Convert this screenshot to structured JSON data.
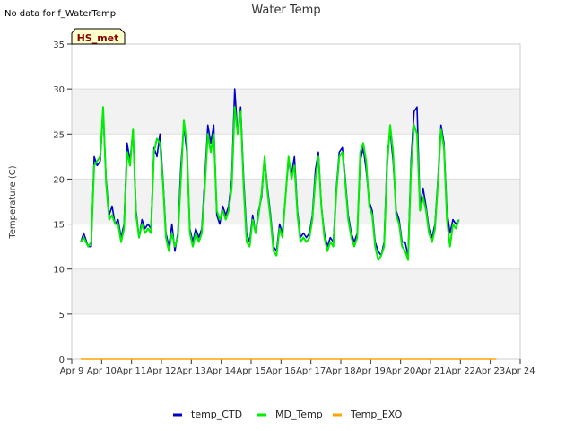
{
  "notice": "No data for f_WaterTemp",
  "badge": "HS_met",
  "chart_data": {
    "type": "line",
    "title": "Water Temp",
    "xlabel": "",
    "ylabel": "Temperature (C)",
    "xlim": [
      "Apr 9",
      "Apr 24"
    ],
    "ylim": [
      0,
      35
    ],
    "x_tick_labels": [
      "Apr 9",
      "Apr 10",
      "Apr 11",
      "Apr 12",
      "Apr 13",
      "Apr 14",
      "Apr 15",
      "Apr 16",
      "Apr 17",
      "Apr 18",
      "Apr 19",
      "Apr 20",
      "Apr 21",
      "Apr 22",
      "Apr 23",
      "Apr 24"
    ],
    "y_ticks": [
      0,
      5,
      10,
      15,
      20,
      25,
      30,
      35
    ],
    "grid": true,
    "legend_position": "bottom",
    "series": [
      {
        "name": "temp_CTD",
        "color": "#0000cc",
        "x_days": [
          9.3,
          9.4,
          9.55,
          9.65,
          9.75,
          9.85,
          9.95,
          10.05,
          10.15,
          10.25,
          10.35,
          10.45,
          10.55,
          10.65,
          10.75,
          10.85,
          10.95,
          11.05,
          11.15,
          11.25,
          11.35,
          11.45,
          11.55,
          11.65,
          11.75,
          11.85,
          11.95,
          12.05,
          12.15,
          12.25,
          12.35,
          12.45,
          12.55,
          12.65,
          12.75,
          12.85,
          12.95,
          13.05,
          13.15,
          13.25,
          13.35,
          13.45,
          13.55,
          13.65,
          13.75,
          13.85,
          13.95,
          14.05,
          14.15,
          14.25,
          14.35,
          14.45,
          14.55,
          14.65,
          14.75,
          14.85,
          14.95,
          15.05,
          15.15,
          15.25,
          15.35,
          15.45,
          15.55,
          15.65,
          15.75,
          15.85,
          15.95,
          16.05,
          16.15,
          16.25,
          16.35,
          16.45,
          16.55,
          16.65,
          16.75,
          16.85,
          16.95,
          17.05,
          17.15,
          17.25,
          17.35,
          17.45,
          17.55,
          17.65,
          17.75,
          17.85,
          17.95,
          18.05,
          18.15,
          18.25,
          18.35,
          18.45,
          18.55,
          18.65,
          18.75,
          18.85,
          18.95,
          19.05,
          19.15,
          19.25,
          19.35,
          19.45,
          19.55,
          19.65,
          19.75,
          19.85,
          19.95,
          20.05,
          20.15,
          20.25,
          20.35,
          20.45,
          20.55,
          20.65,
          20.75,
          20.85,
          20.95,
          21.05,
          21.15,
          21.25,
          21.35,
          21.45,
          21.55,
          21.65,
          21.75,
          21.85,
          21.95,
          22.05,
          22.15,
          22.25,
          22.35,
          22.45,
          22.55,
          22.65,
          22.75,
          22.85,
          22.95,
          23.05,
          23.15,
          23.25
        ],
        "values": [
          13.0,
          14.0,
          12.5,
          12.5,
          22.5,
          21.5,
          22.0,
          27.5,
          20.0,
          16.0,
          17.0,
          15.0,
          15.5,
          13.5,
          15.0,
          24.0,
          22.0,
          25.5,
          16.5,
          13.5,
          15.5,
          14.5,
          15.0,
          14.5,
          23.5,
          22.5,
          25.0,
          20.0,
          14.0,
          12.5,
          15.0,
          12.0,
          14.0,
          21.5,
          26.0,
          23.0,
          14.5,
          13.0,
          14.5,
          13.5,
          14.5,
          20.0,
          26.0,
          24.0,
          26.0,
          16.0,
          15.0,
          17.0,
          16.0,
          17.0,
          20.0,
          30.0,
          25.0,
          28.0,
          20.0,
          14.0,
          13.0,
          16.0,
          14.0,
          16.5,
          18.0,
          22.5,
          19.0,
          16.0,
          12.5,
          12.0,
          15.0,
          14.0,
          18.0,
          22.0,
          20.5,
          22.5,
          16.5,
          13.5,
          14.0,
          13.5,
          14.0,
          16.0,
          21.0,
          23.0,
          17.0,
          14.0,
          12.5,
          13.5,
          13.0,
          19.0,
          23.0,
          23.5,
          20.0,
          16.0,
          14.0,
          13.0,
          14.0,
          22.0,
          23.5,
          21.0,
          17.5,
          16.5,
          13.0,
          12.0,
          11.5,
          13.0,
          22.5,
          25.5,
          22.0,
          16.5,
          15.5,
          13.0,
          13.0,
          11.5,
          22.0,
          27.5,
          28.0,
          17.0,
          19.0,
          17.0,
          14.5,
          13.5,
          15.0,
          20.0,
          26.0,
          24.0,
          16.5,
          14.0,
          15.5,
          15.0,
          15.5
        ]
      },
      {
        "name": "MD_Temp",
        "color": "#00ee00",
        "x_days": [
          9.3,
          9.4,
          9.55,
          9.65,
          9.75,
          9.85,
          9.95,
          10.05,
          10.15,
          10.25,
          10.35,
          10.45,
          10.55,
          10.65,
          10.75,
          10.85,
          10.95,
          11.05,
          11.15,
          11.25,
          11.35,
          11.45,
          11.55,
          11.65,
          11.75,
          11.85,
          11.95,
          12.05,
          12.15,
          12.25,
          12.35,
          12.45,
          12.55,
          12.65,
          12.75,
          12.85,
          12.95,
          13.05,
          13.15,
          13.25,
          13.35,
          13.45,
          13.55,
          13.65,
          13.75,
          13.85,
          13.95,
          14.05,
          14.15,
          14.25,
          14.35,
          14.45,
          14.55,
          14.65,
          14.75,
          14.85,
          14.95,
          15.05,
          15.15,
          15.25,
          15.35,
          15.45,
          15.55,
          15.65,
          15.75,
          15.85,
          15.95,
          16.05,
          16.15,
          16.25,
          16.35,
          16.45,
          16.55,
          16.65,
          16.75,
          16.85,
          16.95,
          17.05,
          17.15,
          17.25,
          17.35,
          17.45,
          17.55,
          17.65,
          17.75,
          17.85,
          17.95,
          18.05,
          18.15,
          18.25,
          18.35,
          18.45,
          18.55,
          18.65,
          18.75,
          18.85,
          18.95,
          19.05,
          19.15,
          19.25,
          19.35,
          19.45,
          19.55,
          19.65,
          19.75,
          19.85,
          19.95,
          20.05,
          20.15,
          20.25,
          20.35,
          20.45,
          20.55,
          20.65,
          20.75,
          20.85,
          20.95,
          21.05,
          21.15,
          21.25,
          21.35,
          21.45,
          21.55,
          21.65,
          21.75,
          21.85,
          21.95,
          22.05,
          22.15,
          22.25,
          22.35,
          22.45,
          22.55,
          22.65,
          22.75,
          22.85,
          22.95,
          23.05,
          23.15,
          23.25
        ],
        "values": [
          13.0,
          13.5,
          12.5,
          13.0,
          21.5,
          22.0,
          22.5,
          28.0,
          19.5,
          15.5,
          16.0,
          15.0,
          15.0,
          13.0,
          14.5,
          23.0,
          21.5,
          25.5,
          16.0,
          13.5,
          15.0,
          14.0,
          14.5,
          14.0,
          23.0,
          24.5,
          24.0,
          19.5,
          13.5,
          12.0,
          14.0,
          12.5,
          13.5,
          20.0,
          26.5,
          24.0,
          14.0,
          12.5,
          14.0,
          13.0,
          14.0,
          19.0,
          25.0,
          23.0,
          25.0,
          16.5,
          15.5,
          16.5,
          15.5,
          16.5,
          19.0,
          28.0,
          25.0,
          27.5,
          19.0,
          13.0,
          12.5,
          15.5,
          14.0,
          16.0,
          18.5,
          22.5,
          18.5,
          15.5,
          12.0,
          11.5,
          14.5,
          13.5,
          18.0,
          22.5,
          20.0,
          21.5,
          16.0,
          13.0,
          13.5,
          13.0,
          13.5,
          15.5,
          20.0,
          22.5,
          17.0,
          13.5,
          12.0,
          13.0,
          12.5,
          18.5,
          22.5,
          23.0,
          19.5,
          15.5,
          13.5,
          12.5,
          13.5,
          23.0,
          24.0,
          22.0,
          17.0,
          16.0,
          12.5,
          11.0,
          11.5,
          12.5,
          21.5,
          26.0,
          23.0,
          16.0,
          15.0,
          12.5,
          12.0,
          11.0,
          21.0,
          26.0,
          25.0,
          16.5,
          18.0,
          16.5,
          14.0,
          13.0,
          14.5,
          19.5,
          25.5,
          23.5,
          15.5,
          12.5,
          15.0,
          14.5,
          15.5
        ]
      },
      {
        "name": "Temp_EXO",
        "color": "#ffa500",
        "x_days": [
          9.3,
          23.2
        ],
        "values": [
          0,
          0
        ]
      }
    ]
  }
}
